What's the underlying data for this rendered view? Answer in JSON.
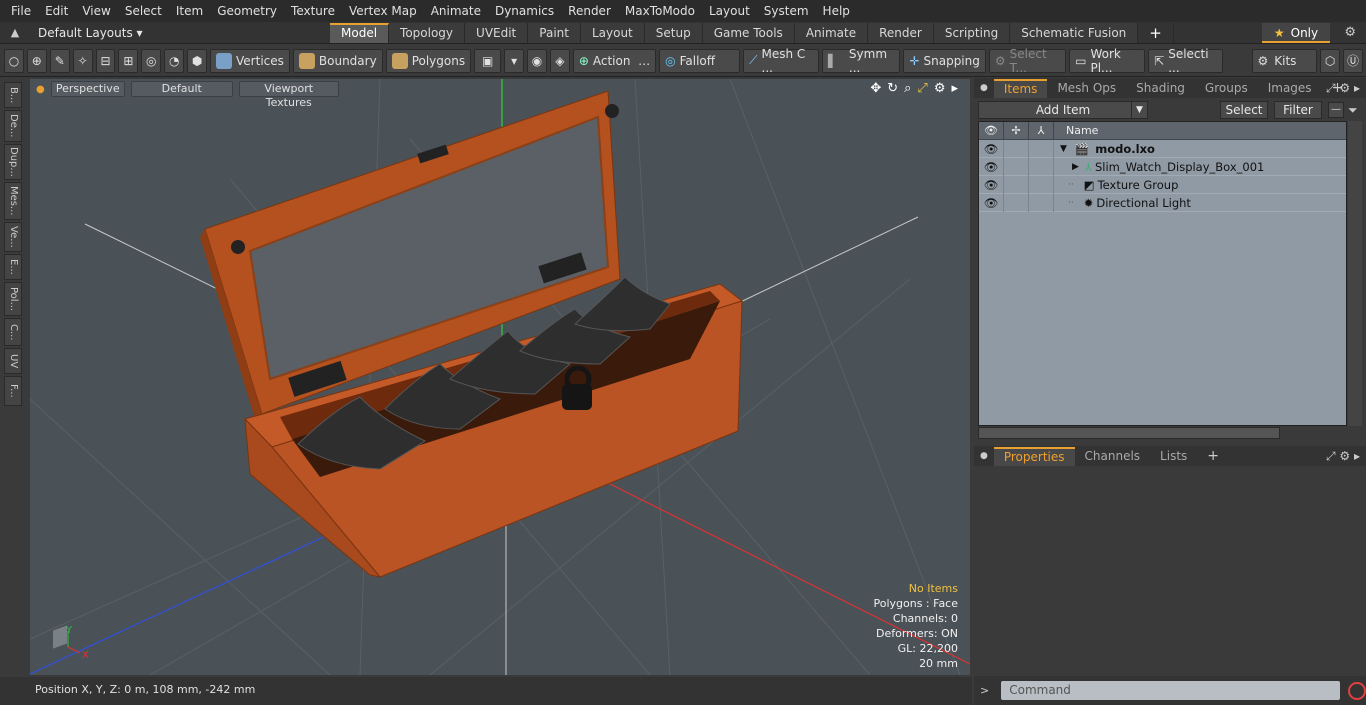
{
  "menu": [
    "File",
    "Edit",
    "View",
    "Select",
    "Item",
    "Geometry",
    "Texture",
    "Vertex Map",
    "Animate",
    "Dynamics",
    "Render",
    "MaxToModo",
    "Layout",
    "System",
    "Help"
  ],
  "layout_select": "Default Layouts ▾",
  "tabs": [
    "Model",
    "Topology",
    "UVEdit",
    "Paint",
    "Layout",
    "Setup",
    "Game Tools",
    "Animate",
    "Render",
    "Scripting",
    "Schematic Fusion"
  ],
  "only_label": "Only",
  "toolbar": {
    "vertices": "Vertices",
    "boundary": "Boundary",
    "polygons": "Polygons",
    "action": "Action",
    "falloff": "Falloff",
    "mesh": "Mesh C ...",
    "symm": "Symm ...",
    "snapping": "Snapping",
    "select_t": "Select T...",
    "work_pl": "Work Pl...",
    "selecti": "Selecti ...",
    "kits": "Kits"
  },
  "left_tabs": [
    "B...",
    "De...",
    "Dup...",
    "Mes...",
    "Ve...",
    "E...",
    "Pol...",
    "C...",
    "UV",
    "F..."
  ],
  "viewport": {
    "perspective": "Perspective",
    "default": "Default",
    "viewport_textures": "Viewport Textures",
    "info": {
      "no_items": "No Items",
      "polygons": "Polygons : Face",
      "channels": "Channels: 0",
      "deformers": "Deformers: ON",
      "gl": "GL: 22,200",
      "scale": "20 mm"
    }
  },
  "status": "Position X, Y, Z:   0 m, 108 mm, -242 mm",
  "right_tabs": [
    "Items",
    "Mesh Ops",
    "Shading",
    "Groups",
    "Images"
  ],
  "items_controls": {
    "add_item": "Add Item",
    "select": "Select",
    "filter": "Filter"
  },
  "items_header": {
    "name": "Name"
  },
  "items": [
    {
      "name": "modo.lxo",
      "bold": true
    },
    {
      "name": "Slim_Watch_Display_Box_001",
      "bold": false
    },
    {
      "name": "Texture Group",
      "bold": false
    },
    {
      "name": "Directional Light",
      "bold": false
    }
  ],
  "prop_tabs": [
    "Properties",
    "Channels",
    "Lists"
  ],
  "command_placeholder": "Command",
  "colors": {
    "accent": "#e8a030",
    "wood": "#c45a28",
    "viewport_bg": "#4b5257"
  }
}
